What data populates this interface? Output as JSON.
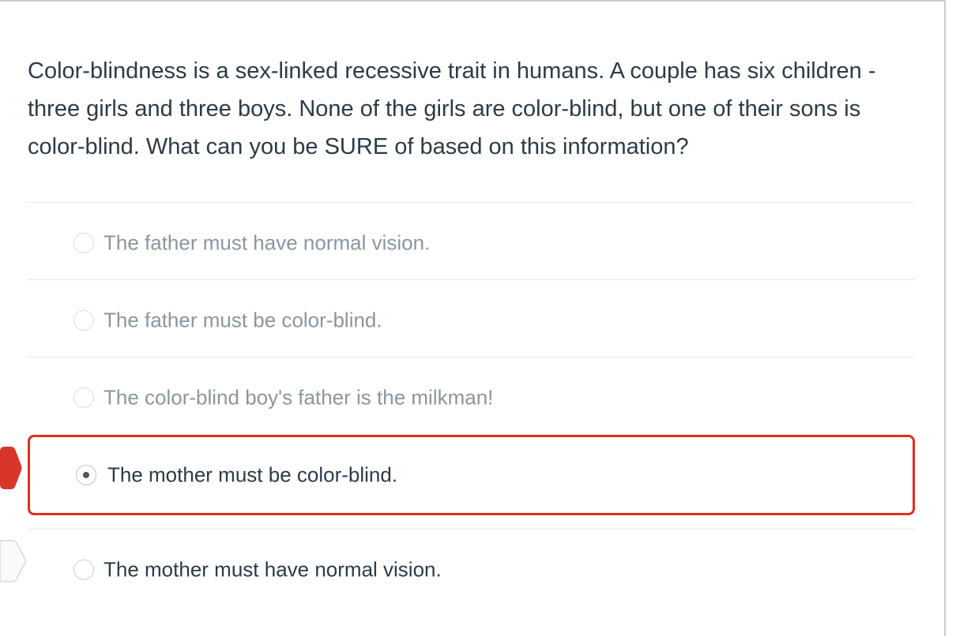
{
  "question": {
    "text": "Color-blindness is a sex-linked recessive trait in humans. A couple has six children - three girls and three boys. None of the girls are color-blind, but one of their sons is color-blind. What can you be SURE of based on this information?"
  },
  "answers": [
    {
      "label": "The father must have normal vision.",
      "selected": false
    },
    {
      "label": "The father must be color-blind.",
      "selected": false
    },
    {
      "label": "The color-blind boy's father is the milkman!",
      "selected": false
    },
    {
      "label": "The mother must be color-blind.",
      "selected": true
    },
    {
      "label": "The mother must have normal vision.",
      "selected": false
    }
  ],
  "colors": {
    "incorrect_marker": "#d9362b",
    "selected_border": "#e0301e",
    "text": "#2d3b45",
    "dim_text": "#8b969e"
  },
  "icons": {
    "incorrect_marker": "incorrect-answer-arrow-icon",
    "correct_marker": "correct-answer-arrow-icon"
  }
}
